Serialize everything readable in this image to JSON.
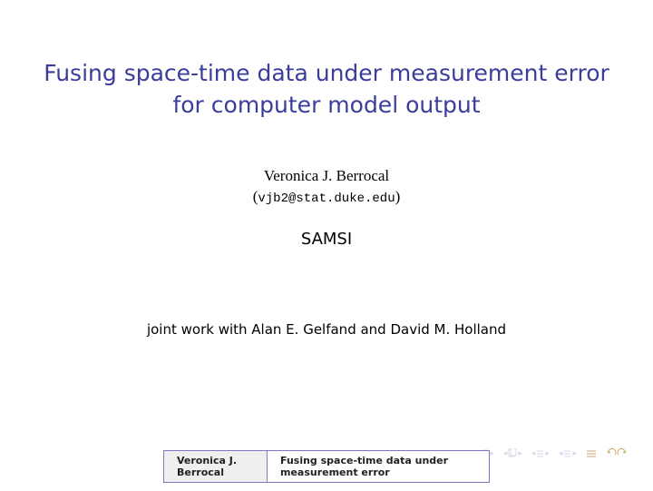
{
  "title_line1": "Fusing space-time data under measurement error",
  "title_line2": "for computer model output",
  "author": "Veronica J. Berrocal",
  "email": "vjb2@stat.duke.edu",
  "affiliation": "SAMSI",
  "joint": "joint work with Alan E. Gelfand and David M. Holland",
  "footer": {
    "author": "Veronica J. Berrocal",
    "title": "Fusing space-time data under measurement error"
  }
}
